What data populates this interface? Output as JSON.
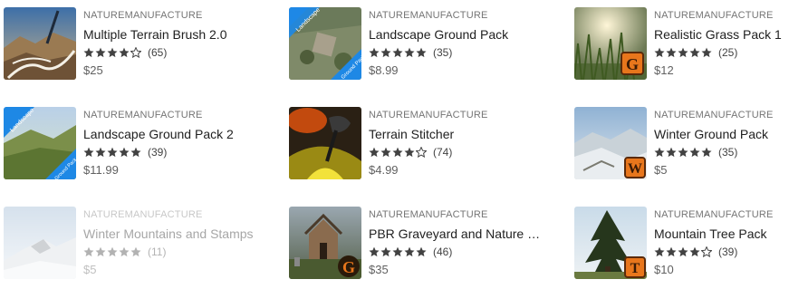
{
  "products": [
    {
      "publisher": "NATUREMANUFACTURE",
      "title": "Multiple Terrain Brush 2.0",
      "rating": 4,
      "reviews": "(65)",
      "price": "$25",
      "thumb": "brush-terrain-thumbnail"
    },
    {
      "publisher": "NATUREMANUFACTURE",
      "title": "Landscape Ground Pack",
      "rating": 5,
      "reviews": "(35)",
      "price": "$8.99",
      "thumb": "ground-pack-thumbnail",
      "ribbon_top": "Landscape",
      "ribbon_bottom": "Ground Pack"
    },
    {
      "publisher": "NATUREMANUFACTURE",
      "title": "Realistic Grass Pack 1",
      "rating": 5,
      "reviews": "(25)",
      "price": "$12",
      "thumb": "grass-thumbnail",
      "badge": "G"
    },
    {
      "publisher": "NATUREMANUFACTURE",
      "title": "Landscape Ground Pack 2",
      "rating": 5,
      "reviews": "(39)",
      "price": "$11.99",
      "thumb": "ground-pack-2-thumbnail",
      "ribbon_top": "Landscape",
      "ribbon_bottom": "Ground Pack 2"
    },
    {
      "publisher": "NATUREMANUFACTURE",
      "title": "Terrain Stitcher",
      "rating": 4,
      "reviews": "(74)",
      "price": "$4.99",
      "thumb": "terrain-stitcher-thumbnail"
    },
    {
      "publisher": "NATUREMANUFACTURE",
      "title": "Winter Ground Pack",
      "rating": 5,
      "reviews": "(35)",
      "price": "$5",
      "thumb": "winter-ground-thumbnail",
      "badge": "W"
    },
    {
      "publisher": "NATUREMANUFACTURE",
      "title": "Winter Mountains and Stamps",
      "rating": 5,
      "reviews": "(11)",
      "price": "$5",
      "thumb": "winter-mountains-thumbnail",
      "dimmed": true
    },
    {
      "publisher": "NATUREMANUFACTURE",
      "title": "PBR Graveyard and Nature Se...",
      "rating": 5,
      "reviews": "(46)",
      "price": "$35",
      "thumb": "graveyard-thumbnail",
      "badge": "G"
    },
    {
      "publisher": "NATUREMANUFACTURE",
      "title": "Mountain Tree Pack",
      "rating": 4,
      "reviews": "(39)",
      "price": "$10",
      "thumb": "mountain-tree-thumbnail",
      "badge": "T"
    }
  ],
  "colors": {
    "star_filled": "#424242",
    "star_empty": "#424242",
    "badge_orange": "#e8761c"
  }
}
